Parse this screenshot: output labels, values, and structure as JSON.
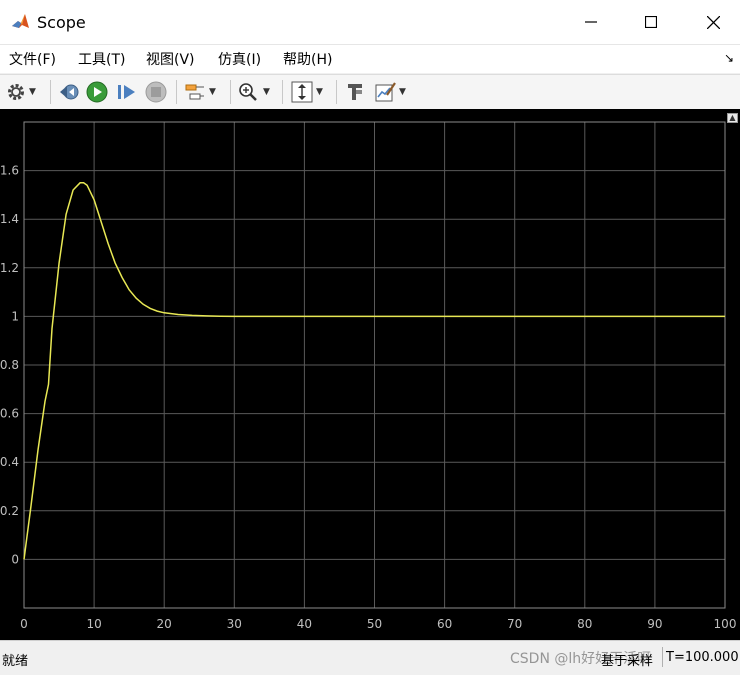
{
  "window": {
    "title": "Scope"
  },
  "menu": [
    {
      "label": "文件(F)"
    },
    {
      "label": "工具(T)"
    },
    {
      "label": "视图(V)"
    },
    {
      "label": "仿真(I)"
    },
    {
      "label": "帮助(H)"
    }
  ],
  "toolbar": {
    "icons": [
      "settings-icon",
      "step-back-icon",
      "run-icon",
      "step-forward-icon",
      "stop-icon",
      "signal-select-icon",
      "zoom-icon",
      "scale-axes-icon",
      "highlight-block-icon",
      "style-icon"
    ]
  },
  "status": {
    "left": "就绪",
    "mode": "基于采样",
    "time": "T=100.000"
  },
  "watermark": "CSDN @lh好好干活呀",
  "colors": {
    "plot_bg": "#000000",
    "grid": "#5a5a5a",
    "line": "#e8e854",
    "tick_text": "#bfbfbf"
  },
  "chart_data": {
    "type": "line",
    "title": "",
    "xlabel": "",
    "ylabel": "",
    "xlim": [
      0,
      100
    ],
    "ylim": [
      -0.2,
      1.8
    ],
    "grid": true,
    "xticks": [
      0,
      10,
      20,
      30,
      40,
      50,
      60,
      70,
      80,
      90,
      100
    ],
    "yticks": [
      0,
      0.2,
      0.4,
      0.6,
      0.8,
      1,
      1.2,
      1.4,
      1.6
    ],
    "xticklabels": [
      "0",
      "10",
      "20",
      "30",
      "40",
      "50",
      "60",
      "70",
      "80",
      "90",
      "100"
    ],
    "yticklabels": [
      "0",
      "0.2",
      "0.4",
      "0.6",
      "0.8",
      "1",
      "1.2",
      "1.4",
      "1.6"
    ],
    "series": [
      {
        "color": "#e8e854",
        "x": [
          0,
          1,
          2,
          3,
          3.5,
          4,
          5,
          6,
          7,
          8,
          8.5,
          9,
          10,
          11,
          12,
          13,
          14,
          15,
          16,
          17,
          18,
          19,
          20,
          22,
          24,
          26,
          28,
          30,
          33,
          36,
          40,
          50,
          60,
          70,
          80,
          90,
          100
        ],
        "y": [
          0,
          0.22,
          0.45,
          0.65,
          0.72,
          0.95,
          1.22,
          1.42,
          1.52,
          1.55,
          1.55,
          1.54,
          1.48,
          1.39,
          1.3,
          1.22,
          1.16,
          1.11,
          1.075,
          1.05,
          1.033,
          1.022,
          1.015,
          1.008,
          1.004,
          1.002,
          1.001,
          1.0,
          1.0,
          1.0,
          1.0,
          1.0,
          1.0,
          1.0,
          1.0,
          1.0,
          1.0
        ]
      }
    ]
  }
}
